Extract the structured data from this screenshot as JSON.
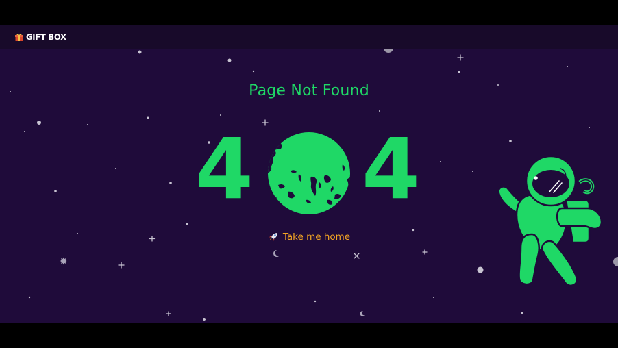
{
  "navbar": {
    "brand": "GIFT BOX",
    "brand_icon": "gift-icon"
  },
  "error": {
    "title": "Page Not Found",
    "digit_left": "4",
    "digit_right": "4"
  },
  "home_link": {
    "label": "Take me home",
    "icon": "rocket-icon"
  },
  "colors": {
    "background": "#1f0b3a",
    "navbar": "#180a2a",
    "accent_green": "#1fd866",
    "link_orange": "#f5a623",
    "star": "#c8c4d2"
  }
}
